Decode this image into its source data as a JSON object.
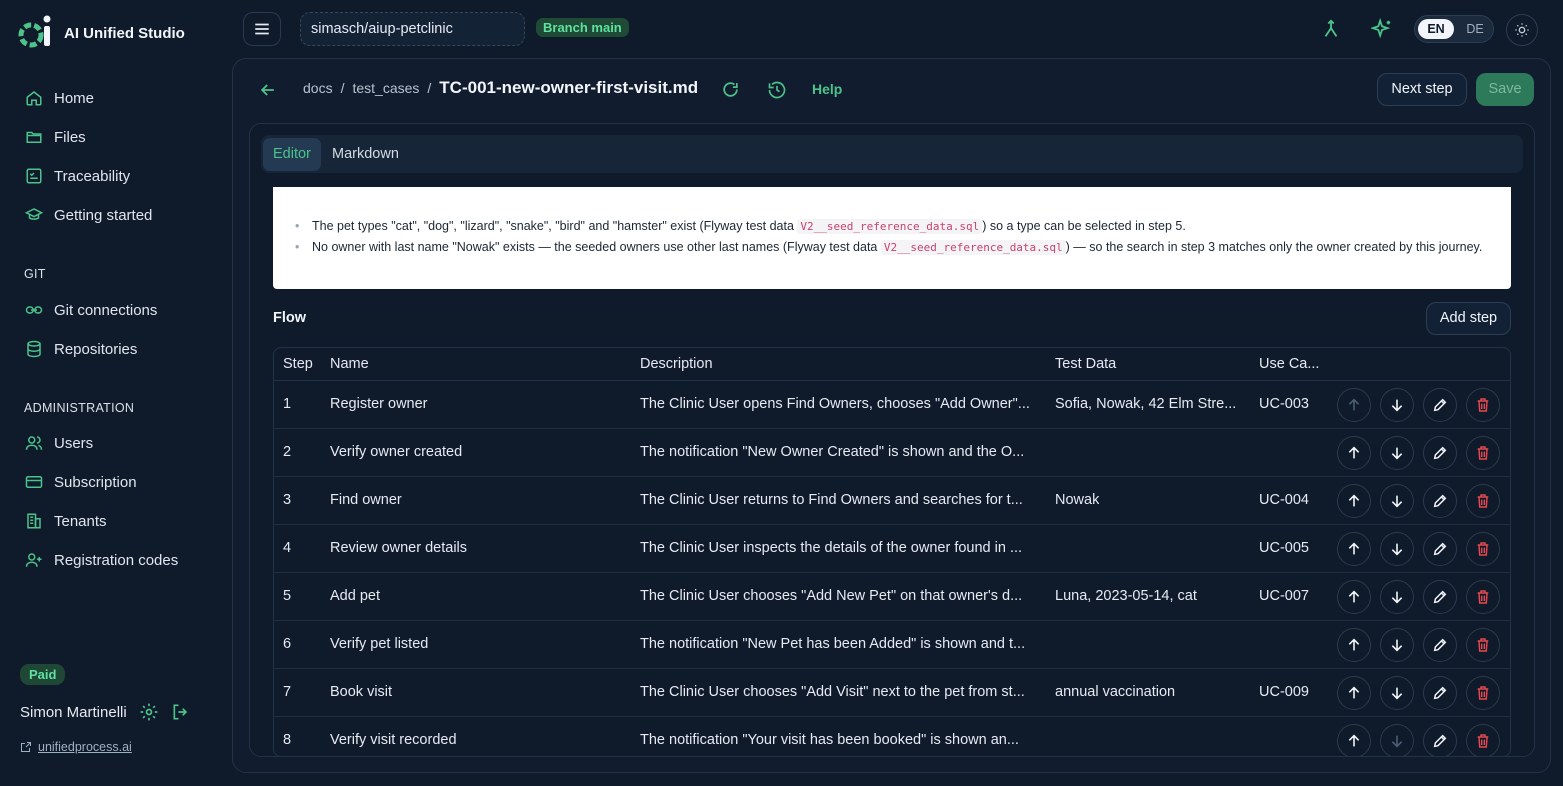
{
  "app": {
    "title": "AI Unified Studio"
  },
  "sidebar": {
    "nav": [
      {
        "label": "Home",
        "icon": "home-icon"
      },
      {
        "label": "Files",
        "icon": "folder-icon"
      },
      {
        "label": "Traceability",
        "icon": "checklist-icon"
      },
      {
        "label": "Getting started",
        "icon": "graduation-cap-icon"
      }
    ],
    "git_section": "GIT",
    "git_items": [
      {
        "label": "Git connections",
        "icon": "link-icon"
      },
      {
        "label": "Repositories",
        "icon": "database-icon"
      }
    ],
    "admin_section": "ADMINISTRATION",
    "admin_items": [
      {
        "label": "Users",
        "icon": "users-icon"
      },
      {
        "label": "Subscription",
        "icon": "credit-card-icon"
      },
      {
        "label": "Tenants",
        "icon": "building-icon"
      },
      {
        "label": "Registration codes",
        "icon": "user-plus-icon"
      }
    ],
    "plan_badge": "Paid",
    "user_name": "Simon Martinelli",
    "external_link": "unifiedprocess.ai"
  },
  "topbar": {
    "repo": "simasch/aiup-petclinic",
    "branch": "Branch main",
    "lang_active": "EN",
    "lang_other": "DE"
  },
  "breadcrumb": {
    "items": [
      "docs",
      "test_cases"
    ],
    "current": "TC-001-new-owner-first-visit.md",
    "help": "Help"
  },
  "actions": {
    "next_step": "Next step",
    "save": "Save"
  },
  "editor_tabs": [
    {
      "label": "Editor",
      "active": true
    },
    {
      "label": "Markdown",
      "active": false
    }
  ],
  "preconditions": {
    "item1_pre": "The pet types \"cat\", \"dog\", \"lizard\", \"snake\", \"bird\" and \"hamster\" exist (Flyway test data ",
    "item1_code": "V2__seed_reference_data.sql",
    "item1_post": ") so a type can be selected in step 5.",
    "item2_pre": "No owner with last name \"Nowak\" exists — the seeded owners use other last names (Flyway test data ",
    "item2_code": "V2__seed_reference_data.sql",
    "item2_post": ") — so the search in step 3 matches only the owner created by this journey."
  },
  "flow": {
    "title": "Flow",
    "add_step": "Add step",
    "columns": [
      "Step",
      "Name",
      "Description",
      "Test Data",
      "Use Ca..."
    ],
    "rows": [
      {
        "step": "1",
        "name": "Register owner",
        "description": "The Clinic User opens Find Owners, chooses \"Add Owner\"...",
        "test_data": "Sofia, Nowak, 42 Elm Stre...",
        "use_case": "UC-003"
      },
      {
        "step": "2",
        "name": "Verify owner created",
        "description": "The notification \"New Owner Created\" is shown and the O...",
        "test_data": "",
        "use_case": ""
      },
      {
        "step": "3",
        "name": "Find owner",
        "description": "The Clinic User returns to Find Owners and searches for t...",
        "test_data": "Nowak",
        "use_case": "UC-004"
      },
      {
        "step": "4",
        "name": "Review owner details",
        "description": "The Clinic User inspects the details of the owner found in ...",
        "test_data": "",
        "use_case": "UC-005"
      },
      {
        "step": "5",
        "name": "Add pet",
        "description": "The Clinic User chooses \"Add New Pet\" on that owner's d...",
        "test_data": "Luna, 2023-05-14, cat",
        "use_case": "UC-007"
      },
      {
        "step": "6",
        "name": "Verify pet listed",
        "description": "The notification \"New Pet has been Added\" is shown and t...",
        "test_data": "",
        "use_case": ""
      },
      {
        "step": "7",
        "name": "Book visit",
        "description": "The Clinic User chooses \"Add Visit\" next to the pet from st...",
        "test_data": "annual vaccination",
        "use_case": "UC-009"
      },
      {
        "step": "8",
        "name": "Verify visit recorded",
        "description": "The notification \"Your visit has been booked\" is shown an...",
        "test_data": "",
        "use_case": ""
      }
    ]
  },
  "colors": {
    "accent": "#4cc38a",
    "background": "#0f1a2b",
    "danger": "#e5484d"
  }
}
